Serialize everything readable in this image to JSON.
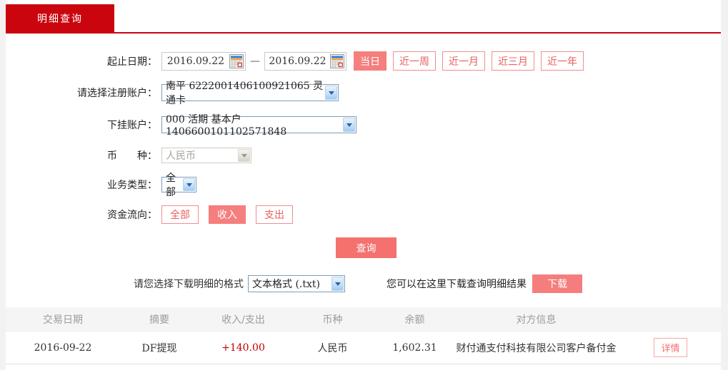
{
  "tab": {
    "label": "明细查询"
  },
  "form": {
    "date_row": {
      "label": "起止日期：",
      "start_date": "2016.09.22",
      "end_date": "2016.09.22",
      "separator": "—",
      "quick_buttons": [
        {
          "label": "当日",
          "active": true
        },
        {
          "label": "近一周",
          "active": false
        },
        {
          "label": "近一月",
          "active": false
        },
        {
          "label": "近三月",
          "active": false
        },
        {
          "label": "近一年",
          "active": false
        }
      ]
    },
    "register_account": {
      "label": "请选择注册账户：",
      "value": "南平 6222001406100921065 灵通卡"
    },
    "sub_account": {
      "label": "下挂账户：",
      "value": "000 活期 基本户 1406600101102571848"
    },
    "currency": {
      "label": "币　　种：",
      "value": "人民币",
      "disabled": true
    },
    "business_type": {
      "label": "业务类型：",
      "value": "全部"
    },
    "fund_flow": {
      "label": "资金流向：",
      "buttons": [
        {
          "label": "全部",
          "active": false
        },
        {
          "label": "收入",
          "active": true
        },
        {
          "label": "支出",
          "active": false
        }
      ]
    },
    "query_button": "查询"
  },
  "download": {
    "format_label": "请您选择下载明细的格式",
    "format_value": "文本格式 (.txt)",
    "hint": "您可以在这里下载查询明细结果",
    "button": "下载"
  },
  "table": {
    "headers": [
      "交易日期",
      "摘要",
      "收入/支出",
      "币种",
      "余额",
      "对方信息"
    ],
    "rows": [
      {
        "date": "2016-09-22",
        "summary": "DF提现",
        "amount": "+140.00",
        "currency": "人民币",
        "balance": "1,602.31",
        "counterparty": "财付通支付科技有限公司客户备付金",
        "detail_button": "详情"
      }
    ]
  },
  "colors": {
    "accent_red": "#cb050e",
    "button_fill": "#f57e7e",
    "button_outline": "#f08f8f",
    "query_fill": "#f4716f",
    "amount_positive": "#c00000",
    "table_header_bg": "#f5f5f5"
  }
}
